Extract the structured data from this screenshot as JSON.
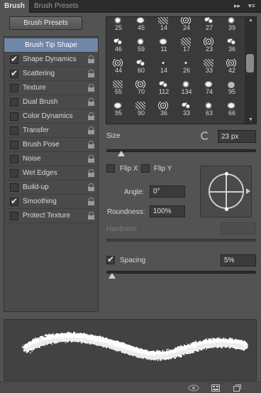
{
  "tabs": [
    {
      "label": "Brush",
      "active": true
    },
    {
      "label": "Brush Presets",
      "active": false
    }
  ],
  "titlebar_icons": [
    "collapse-icon",
    "panel-menu-icon"
  ],
  "presets_button": "Brush Presets",
  "brush_options": [
    {
      "label": "Brush Tip Shape",
      "selected": true,
      "has_checkbox": false,
      "checked": false,
      "locked": false
    },
    {
      "label": "Shape Dynamics",
      "selected": false,
      "has_checkbox": true,
      "checked": true,
      "locked": true
    },
    {
      "label": "Scattering",
      "selected": false,
      "has_checkbox": true,
      "checked": true,
      "locked": true
    },
    {
      "label": "Texture",
      "selected": false,
      "has_checkbox": true,
      "checked": false,
      "locked": true
    },
    {
      "label": "Dual Brush",
      "selected": false,
      "has_checkbox": true,
      "checked": false,
      "locked": true
    },
    {
      "label": "Color Dynamics",
      "selected": false,
      "has_checkbox": true,
      "checked": false,
      "locked": true
    },
    {
      "label": "Transfer",
      "selected": false,
      "has_checkbox": true,
      "checked": false,
      "locked": true
    },
    {
      "label": "Brush Pose",
      "selected": false,
      "has_checkbox": true,
      "checked": false,
      "locked": true
    },
    {
      "label": "Noise",
      "selected": false,
      "has_checkbox": true,
      "checked": false,
      "locked": true
    },
    {
      "label": "Wet Edges",
      "selected": false,
      "has_checkbox": true,
      "checked": false,
      "locked": true
    },
    {
      "label": "Build-up",
      "selected": false,
      "has_checkbox": true,
      "checked": false,
      "locked": true
    },
    {
      "label": "Smoothing",
      "selected": false,
      "has_checkbox": true,
      "checked": true,
      "locked": true
    },
    {
      "label": "Protect Texture",
      "selected": false,
      "has_checkbox": true,
      "checked": false,
      "locked": true
    }
  ],
  "brush_grid": [
    [
      "25",
      "45",
      "14",
      "24",
      "27",
      "39"
    ],
    [
      "46",
      "59",
      "11",
      "17",
      "23",
      "36"
    ],
    [
      "44",
      "60",
      "14",
      "26",
      "33",
      "42"
    ],
    [
      "55",
      "70",
      "112",
      "134",
      "74",
      "95"
    ],
    [
      "95",
      "90",
      "36",
      "33",
      "63",
      "66"
    ]
  ],
  "size": {
    "label": "Size",
    "value": "23 px",
    "slider_fraction": 0.1
  },
  "flip_x": {
    "label": "Flip X",
    "checked": false
  },
  "flip_y": {
    "label": "Flip Y",
    "checked": false
  },
  "angle": {
    "label": "Angle:",
    "value": "0°"
  },
  "roundness": {
    "label": "Roundness:",
    "value": "100%"
  },
  "hardness": {
    "label": "Hardness",
    "enabled": false
  },
  "spacing": {
    "label": "Spacing",
    "checked": true,
    "value": "5%",
    "slider_fraction": 0.02
  },
  "bottom_icons": [
    "eye-icon",
    "brush-panel-icon",
    "create-new-brush-icon"
  ],
  "colors": {
    "selected_row": "#6f87a8",
    "panel_bg": "#535353",
    "titlebar_bg": "#2b2b2b"
  }
}
